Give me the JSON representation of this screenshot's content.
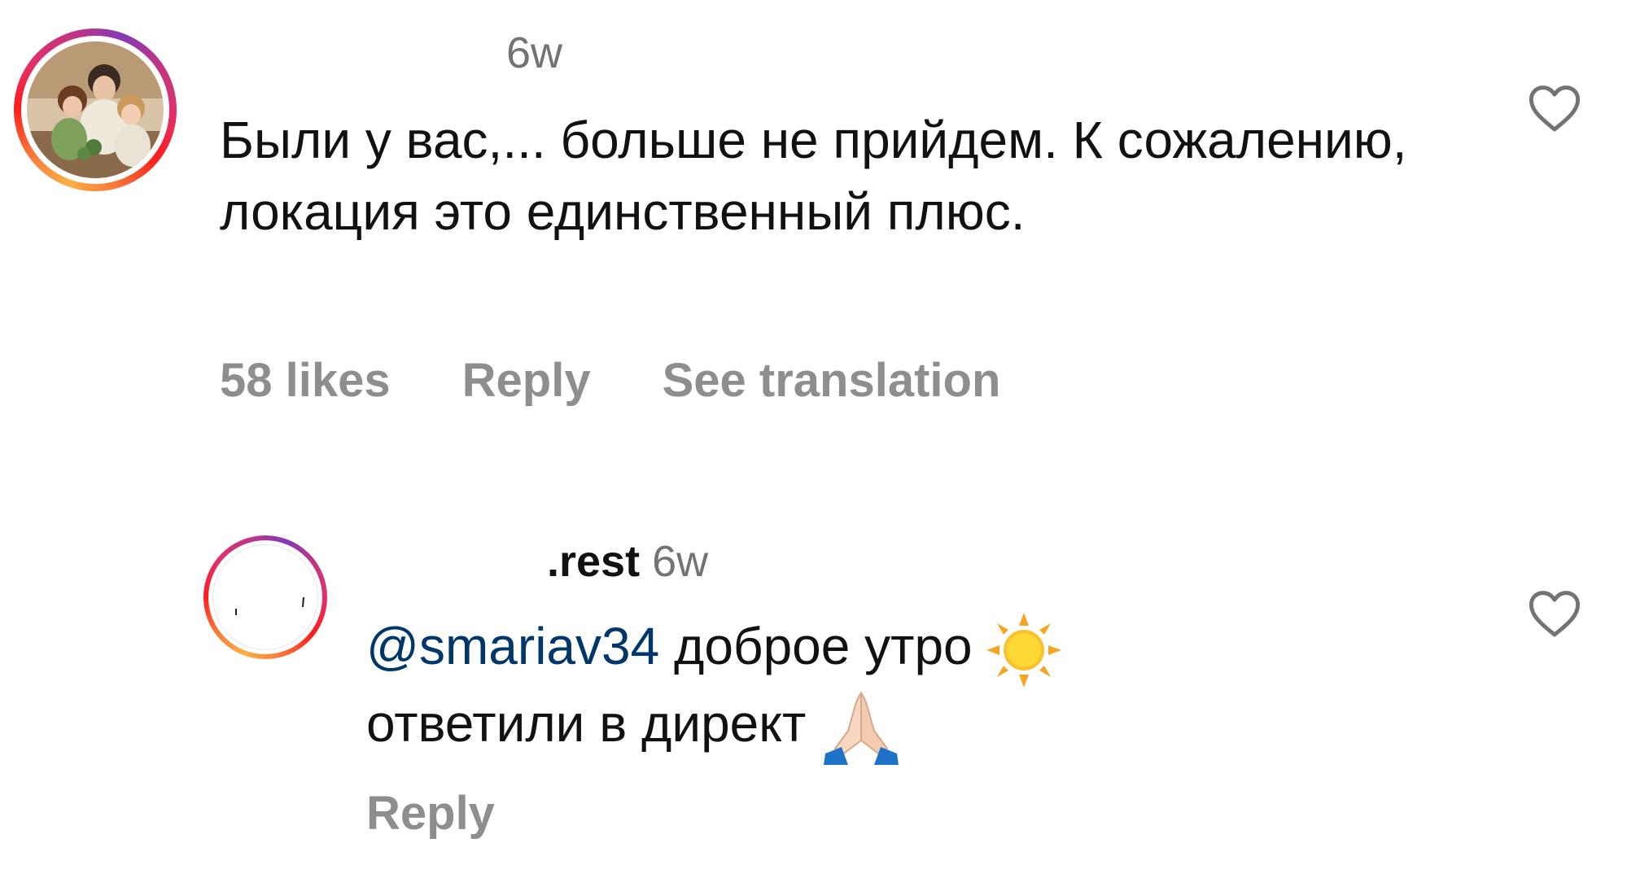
{
  "comments": [
    {
      "username": "",
      "timestamp": "6w",
      "text": "Были у вас,... больше не прийдем. К сожалению, локация это единственный плюс.",
      "likes": "58 likes",
      "reply": "Reply",
      "translate": "See translation"
    },
    {
      "username": ".rest",
      "timestamp": "6w",
      "mention": "@smariav34",
      "text_line1": " доброе утро ",
      "text_line2": "ответили в директ ",
      "emoji_1": "sun-emoji",
      "emoji_2": "folded-hands-emoji",
      "reply": "Reply"
    }
  ],
  "colors": {
    "text": "#111111",
    "muted": "#8e8e8e",
    "timestamp": "#737373",
    "mention": "#00376b",
    "ring_start": "#fcaf45",
    "ring_end": "#c13584"
  },
  "icons": {
    "like": "heart-outline-icon"
  }
}
